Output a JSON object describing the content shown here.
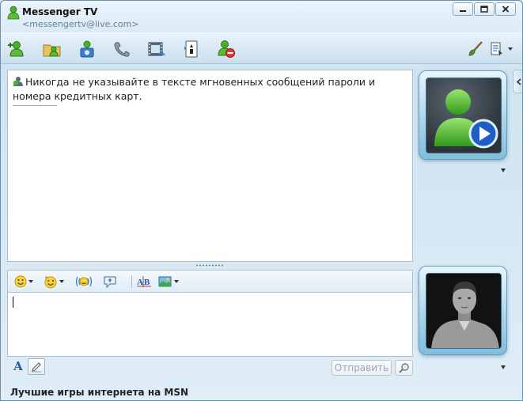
{
  "window": {
    "title": "Messenger TV",
    "subtitle": "<messengertv@live.com>"
  },
  "toolbar": {
    "left_icons": [
      "add-contact-icon",
      "share-folder-icon",
      "video-call-icon",
      "phone-icon",
      "video-icon",
      "games-icon",
      "block-icon"
    ],
    "right_icons": [
      "paint-brush-icon",
      "menu-icon"
    ]
  },
  "history": {
    "warning_text": "Никогда не указывайте в тексте мгновенных сообщений пароли и номера кредитных карт."
  },
  "format_toolbar": {
    "icons": [
      "emoticon-icon",
      "wink-icon",
      "nudge-icon",
      "voice-clip-icon",
      "spellcheck-icon",
      "background-icon"
    ]
  },
  "compose": {
    "value": "",
    "font_label": "A",
    "send_label": "Отправить"
  },
  "footer": {
    "text": "Лучшие игры интернета на MSN"
  },
  "colors": {
    "accent": "#2a56b8",
    "window_bg": "#cfe3f1",
    "frame_border": "#6a9ab8"
  }
}
